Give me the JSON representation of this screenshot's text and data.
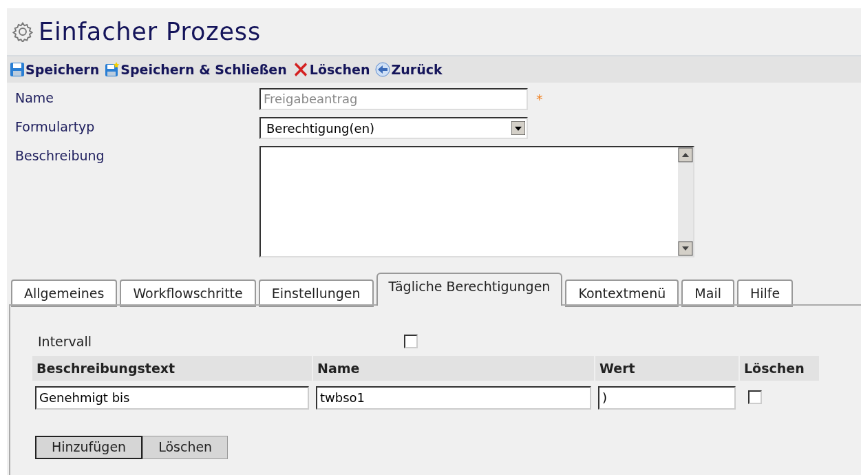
{
  "window": {
    "title": "Einfacher Prozess"
  },
  "toolbar": [
    {
      "label": "Speichern",
      "kind": "save"
    },
    {
      "label": "Speichern & Schließen",
      "kind": "saveclose"
    },
    {
      "label": "Löschen",
      "kind": "delete"
    },
    {
      "label": "Zurück",
      "kind": "back"
    }
  ],
  "form": {
    "name": {
      "label": "Name",
      "value": "Freigabeantrag",
      "disabled": true,
      "required_mark": "*"
    },
    "form_type": {
      "label": "Formulartyp",
      "value": "Berechtigung(en)"
    },
    "description": {
      "label": "Beschreibung"
    }
  },
  "tabs": [
    {
      "label": "Allgemeines",
      "selected": false
    },
    {
      "label": "Workflowschritte",
      "selected": false
    },
    {
      "label": "Einstellungen",
      "selected": false
    },
    {
      "label": "Tägliche Berechtigungen",
      "selected": true
    },
    {
      "label": "Kontextmenü",
      "selected": false
    },
    {
      "label": "Mail",
      "selected": false
    },
    {
      "label": "Hilfe",
      "selected": false
    }
  ],
  "interval": {
    "label": "Intervall",
    "checked": false
  },
  "table": {
    "columns": [
      "Beschreibungstext",
      "Name",
      "Wert",
      "Löschen"
    ],
    "rows": [
      {
        "description": "Genehmigt bis",
        "name": "twbso1",
        "value": ")",
        "delete": false
      }
    ]
  },
  "buttons": [
    {
      "label": "Hinzufügen",
      "selected": true
    },
    {
      "label": "Löschen",
      "selected": false
    }
  ]
}
